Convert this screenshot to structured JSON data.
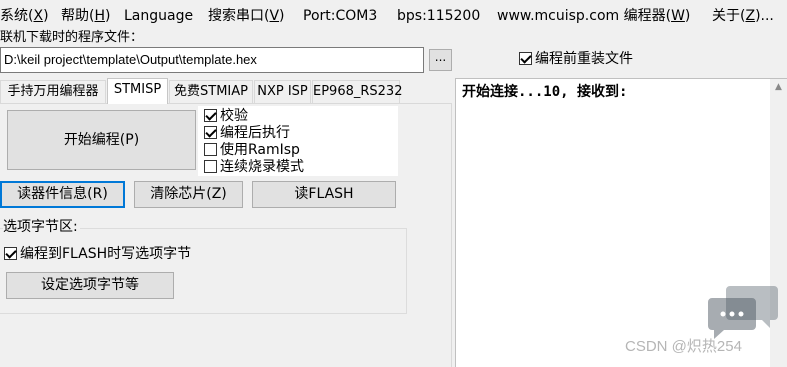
{
  "menu": {
    "system": {
      "label": "系统(",
      "key": "X",
      "tail": ")"
    },
    "help": {
      "label": "帮助(",
      "key": "H",
      "tail": ")"
    },
    "language": "Language",
    "search_port": {
      "label": "搜索串口(",
      "key": "V",
      "tail": ")"
    },
    "port": "Port:COM3",
    "baud": "bps:115200",
    "site": {
      "label": "www.mcuisp.com 编程器(",
      "key": "W",
      "tail": ")"
    },
    "about": {
      "label": "关于(",
      "key": "Z",
      "tail": ")..."
    }
  },
  "program_file": {
    "label": "联机下载时的程序文件：",
    "path": "D:\\keil project\\template\\Output\\template.hex",
    "browse_label": "...",
    "reload_label": "编程前重装文件",
    "reload_checked": true
  },
  "tabs": [
    {
      "label": "手持万用编程器"
    },
    {
      "label": "STMISP"
    },
    {
      "label": "免费STMIAP"
    },
    {
      "label": "NXP ISP"
    },
    {
      "label": "EP968_RS232"
    }
  ],
  "active_tab": "STMISP",
  "stmisp": {
    "start_button": "开始编程(P)",
    "options": [
      {
        "label": "校验",
        "checked": true
      },
      {
        "label": "编程后执行",
        "checked": true
      },
      {
        "label": "使用RamIsp",
        "checked": false
      },
      {
        "label": "连续烧录模式",
        "checked": false
      }
    ],
    "read_info_button": "读器件信息(R)",
    "erase_button": "清除芯片(Z)",
    "read_flash_button": "读FLASH",
    "option_bytes": {
      "group_label": "选项字节区:",
      "write_label": "编程到FLASH时写选项字节",
      "write_checked": true,
      "set_button": "设定选项字节等"
    }
  },
  "output": {
    "text": "开始连接...10, 接收到:"
  },
  "watermark": {
    "text": "CSDN @炽热254"
  }
}
